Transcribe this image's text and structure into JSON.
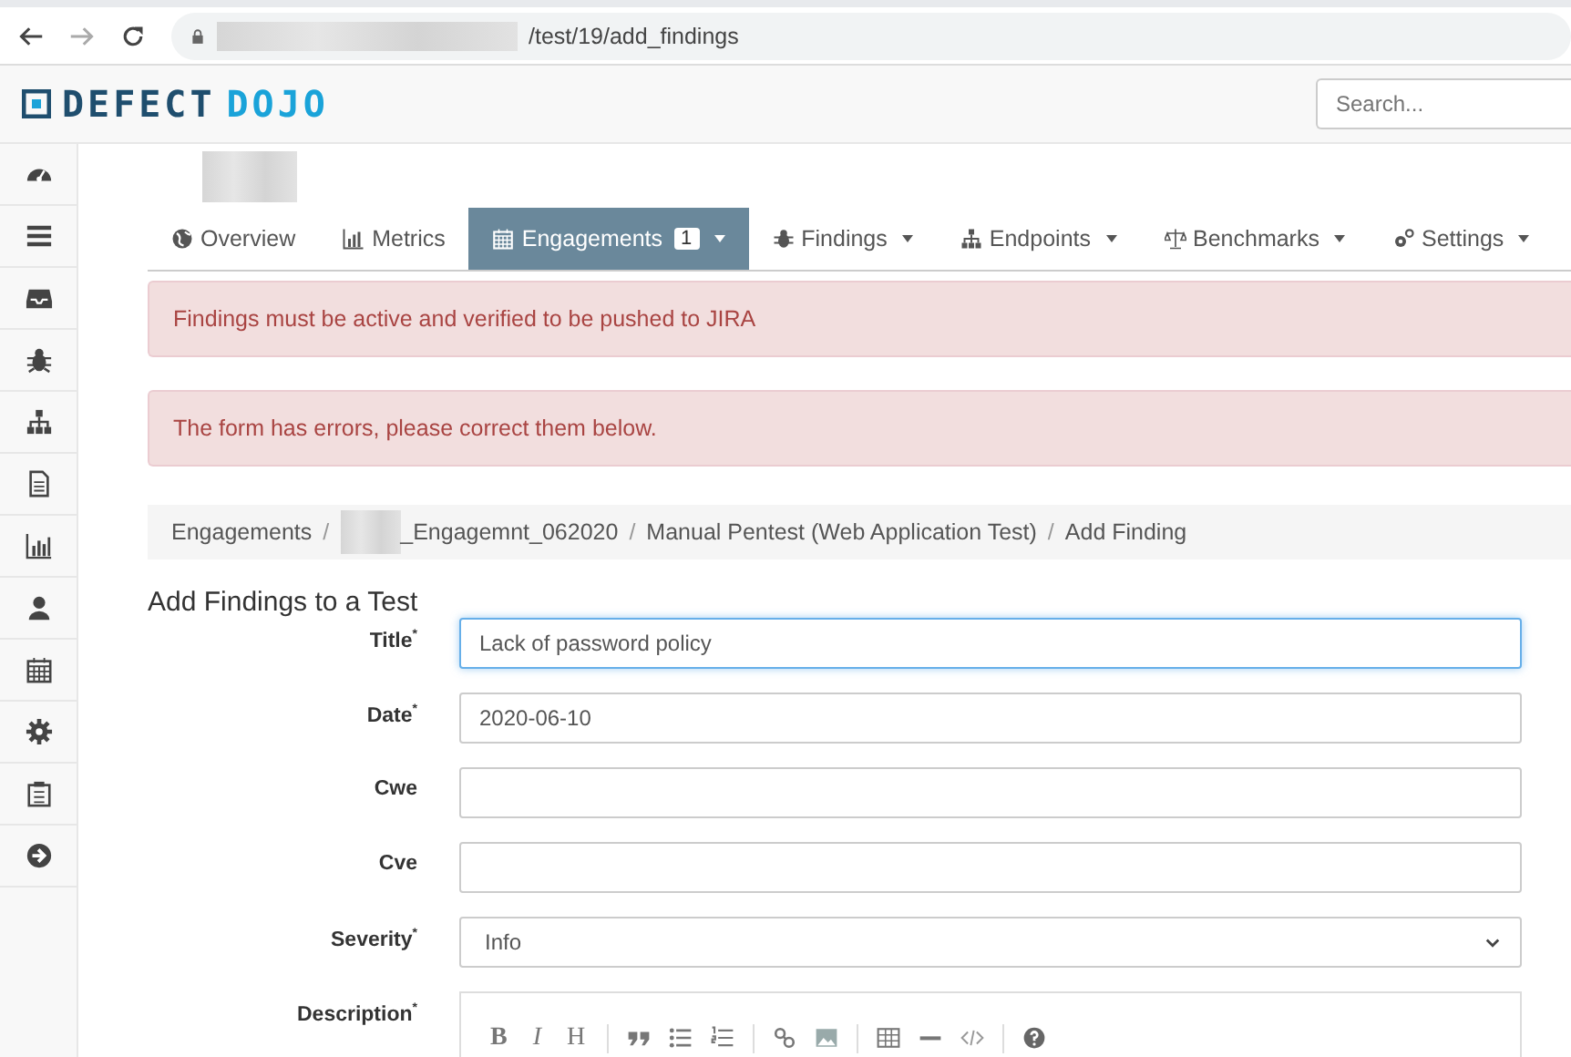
{
  "browser": {
    "url": "/test/19/add_findings"
  },
  "header": {
    "logo": [
      "DEFECT",
      "DOJO"
    ],
    "search": {
      "placeholder": "Search..."
    }
  },
  "tabs": [
    {
      "label": "Overview",
      "selected": false,
      "dropdown": false
    },
    {
      "label": "Metrics",
      "selected": false,
      "dropdown": false
    },
    {
      "label": "Engagements",
      "selected": true,
      "dropdown": true,
      "badge": "1"
    },
    {
      "label": "Findings",
      "selected": false,
      "dropdown": true
    },
    {
      "label": "Endpoints",
      "selected": false,
      "dropdown": true
    },
    {
      "label": "Benchmarks",
      "selected": false,
      "dropdown": true
    },
    {
      "label": "Settings",
      "selected": false,
      "dropdown": true
    }
  ],
  "alerts": [
    "Findings must be active and verified to be pushed to JIRA",
    "The form has errors, please correct them below."
  ],
  "breadcrumb": [
    {
      "text": "Engagements",
      "redacted": false
    },
    {
      "separator": "/",
      "text": "_Engagemnt_062020",
      "redacted": true
    },
    {
      "separator": "/",
      "text": "Manual Pentest (Web Application Test)",
      "redacted": false
    },
    {
      "separator": "/",
      "text": "Add Finding",
      "redacted": false
    }
  ],
  "heading": "Add Findings to a Test",
  "fields": [
    {
      "kind": "text",
      "label": "Title$^{*}$",
      "value": "Lack of password policy",
      "focused": true
    },
    {
      "kind": "text",
      "label": "Date$^{*}$",
      "value": "2020-06-10",
      "focused": false
    },
    {
      "kind": "text",
      "label": "Cwe",
      "focused": false
    },
    {
      "kind": "text",
      "label": "Cve",
      "focused": false
    },
    {
      "kind": "select",
      "label": "Severity$^{*}$",
      "value": "Info",
      "focused": false
    },
    {
      "kind": "editor",
      "label": "Description$^{*}$",
      "toolbar_text": [
        "B",
        "I",
        "H"
      ],
      "focused": false
    }
  ]
}
